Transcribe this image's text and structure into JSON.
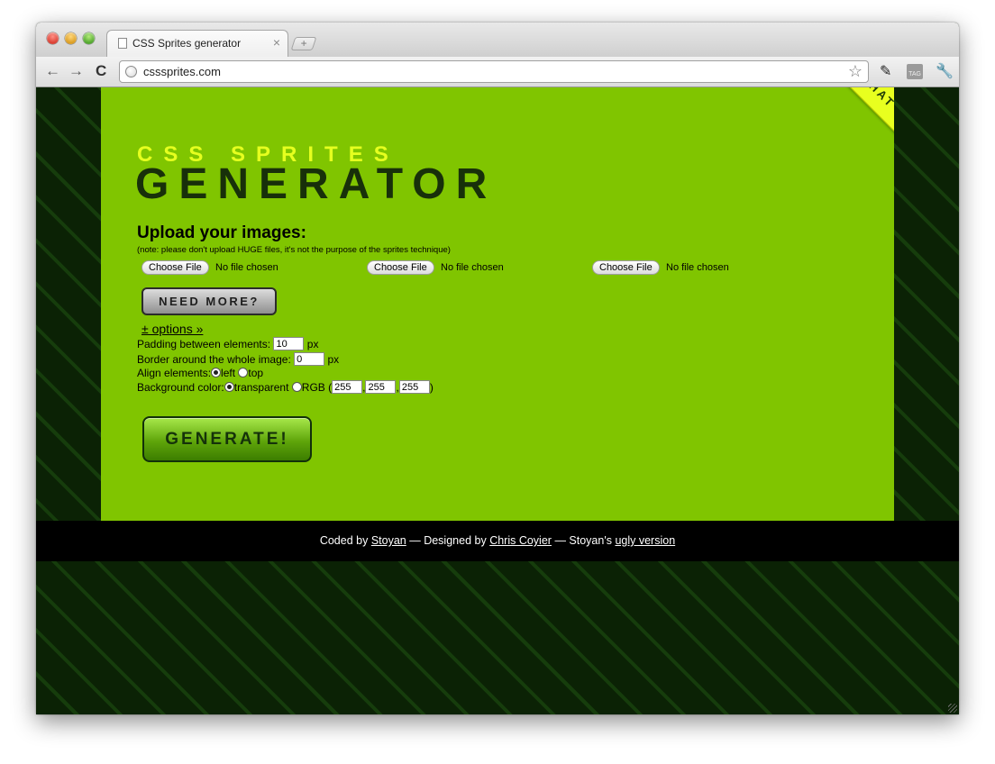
{
  "browser": {
    "tab_title": "CSS Sprites generator",
    "tab_close": "×",
    "new_tab": "+",
    "url": "csssprites.com",
    "back_icon": "←",
    "forward_icon": "→",
    "reload_icon": "C",
    "star_icon": "☆",
    "picker_icon": "✎",
    "tag_icon": "TAG",
    "wrench_icon": "🔧"
  },
  "page": {
    "ribbon": "WHAT'S A SPRITE?",
    "logo_top": "CSS SPRITES",
    "logo_main": "GENERATOR",
    "upload_heading": "Upload your images:",
    "upload_note": "(note: please don't upload HUGE files, it's not the purpose of the sprites technique)",
    "file_inputs": [
      {
        "button": "Choose File",
        "status": "No file chosen"
      },
      {
        "button": "Choose File",
        "status": "No file chosen"
      },
      {
        "button": "Choose File",
        "status": "No file chosen"
      }
    ],
    "need_more": "NEED MORE?",
    "options_link": "± options »",
    "options": {
      "padding_label": "Padding between elements:",
      "padding_value": "10",
      "padding_unit": "px",
      "border_label": "Border around the whole image:",
      "border_value": "0",
      "border_unit": "px",
      "align_label": "Align elements:",
      "align_left": "left",
      "align_top": "top",
      "align_selected": "left",
      "bg_label": "Background color:",
      "bg_transparent": "transparent",
      "bg_rgb": "RGB",
      "bg_selected": "transparent",
      "rgb_open": "(",
      "rgb_sep": ",",
      "rgb_close": ")",
      "r": "255",
      "g": "255",
      "b": "255"
    },
    "generate": "GENERATE!"
  },
  "footer": {
    "coded_by": "Coded by",
    "coder": "Stoyan",
    "designed_by": "— Designed by",
    "designer": "Chris Coyier",
    "ugly_prefix": "— Stoyan's",
    "ugly_link": "ugly version"
  }
}
